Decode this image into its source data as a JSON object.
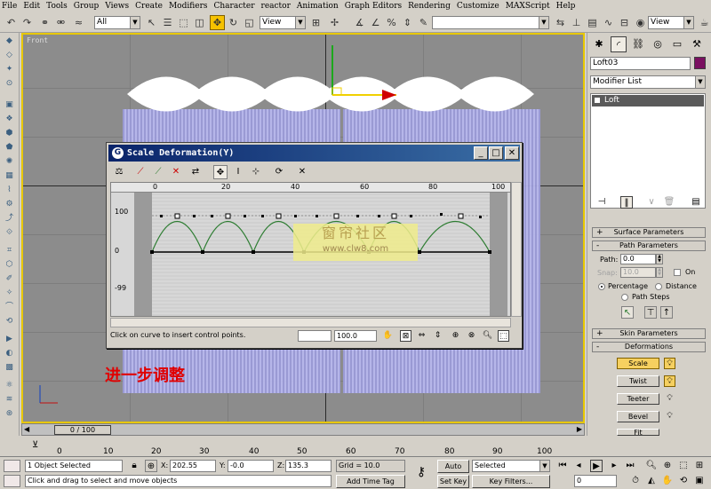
{
  "menu": [
    "File",
    "Edit",
    "Tools",
    "Group",
    "Views",
    "Create",
    "Modifiers",
    "Character",
    "reactor",
    "Animation",
    "Graph Editors",
    "Rendering",
    "Customize",
    "MAXScript",
    "Help"
  ],
  "toolbar": {
    "selection_filter": "All",
    "ref_coord_left": "View",
    "named_selection": "",
    "ref_coord_right": "View"
  },
  "viewport": {
    "label": "Front",
    "annotation": "进一步调整",
    "accent_color": "#e8c800"
  },
  "dialog": {
    "title": "Scale Deformation(Y)",
    "ruler": [
      "0",
      "20",
      "40",
      "60",
      "80",
      "100"
    ],
    "y_labels": [
      "100",
      "0",
      "-99"
    ],
    "status": "Click on curve to insert control points.",
    "field_left": "",
    "field_right": "100.0",
    "curve_color": "#2e7d32"
  },
  "watermark": {
    "line1": "窗帘社区",
    "line2": "www.clw8.com"
  },
  "command_panel": {
    "object_name": "Loft03",
    "object_color": "#7a1060",
    "modifier_list": "Modifier List",
    "stack_item": "Loft",
    "rollouts": {
      "surface": "Surface Parameters",
      "path": "Path Parameters",
      "skin": "Skin Parameters",
      "deformations": "Deformations"
    },
    "path_label": "Path:",
    "path_value": "0.0",
    "snap_label": "Snap:",
    "snap_value": "10.0",
    "on_label": "On",
    "percentage_label": "Percentage",
    "distance_label": "Distance",
    "path_steps_label": "Path Steps",
    "deform_buttons": [
      "Scale",
      "Twist",
      "Teeter",
      "Bevel",
      "Fit"
    ]
  },
  "time": {
    "slider": "0 / 100",
    "ticks": [
      "0",
      "10",
      "20",
      "30",
      "40",
      "50",
      "60",
      "70",
      "80",
      "90",
      "100"
    ]
  },
  "status": {
    "selected": "1 Object Selected",
    "hint": "Click and drag to select and move objects",
    "x_label": "X:",
    "x": "202.55",
    "y_label": "Y:",
    "y": "-0.0",
    "z_label": "Z:",
    "z": "135.3",
    "grid": "Grid = 10.0",
    "add_time_tag": "Add Time Tag",
    "auto_key": "Auto Key",
    "set_key": "Set Key",
    "key_mode": "Selected",
    "key_filters": "Key Filters...",
    "frame": "0"
  }
}
